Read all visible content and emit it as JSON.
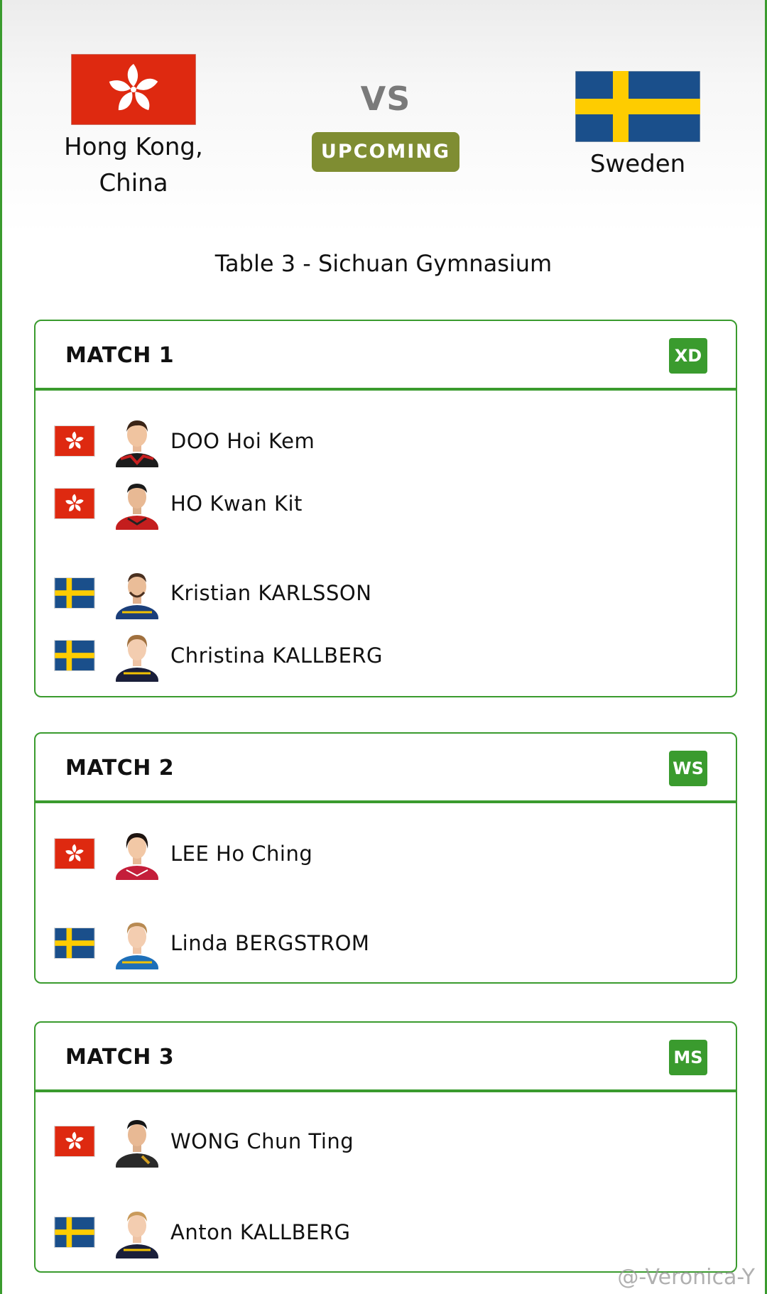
{
  "header": {
    "team_left": {
      "name_line1": "Hong Kong,",
      "name_line2": "China"
    },
    "vs_label": "VS",
    "status": "UPCOMING",
    "team_right": {
      "name": "Sweden"
    },
    "venue": "Table 3 - Sichuan Gymnasium"
  },
  "matches": [
    {
      "title": "MATCH 1",
      "event": "XD",
      "players": [
        {
          "name": "DOO Hoi Kem",
          "flag": "hong-kong-flag"
        },
        {
          "name": "HO Kwan Kit",
          "flag": "hong-kong-flag"
        },
        {
          "name": "Kristian KARLSSON",
          "flag": "sweden-flag"
        },
        {
          "name": "Christina KALLBERG",
          "flag": "sweden-flag"
        }
      ]
    },
    {
      "title": "MATCH 2",
      "event": "WS",
      "players": [
        {
          "name": "LEE Ho Ching",
          "flag": "hong-kong-flag"
        },
        {
          "name": "Linda BERGSTROM",
          "flag": "sweden-flag"
        }
      ]
    },
    {
      "title": "MATCH 3",
      "event": "MS",
      "players": [
        {
          "name": "WONG Chun Ting",
          "flag": "hong-kong-flag"
        },
        {
          "name": "Anton KALLBERG",
          "flag": "sweden-flag"
        }
      ]
    }
  ],
  "watermark": "@-Veronica-Y",
  "colors": {
    "accent_green": "#3a9b2e",
    "status_olive": "#7f8d32",
    "hk_red": "#de2910",
    "se_blue": "#1a4f8b",
    "se_yellow": "#fecc00"
  }
}
